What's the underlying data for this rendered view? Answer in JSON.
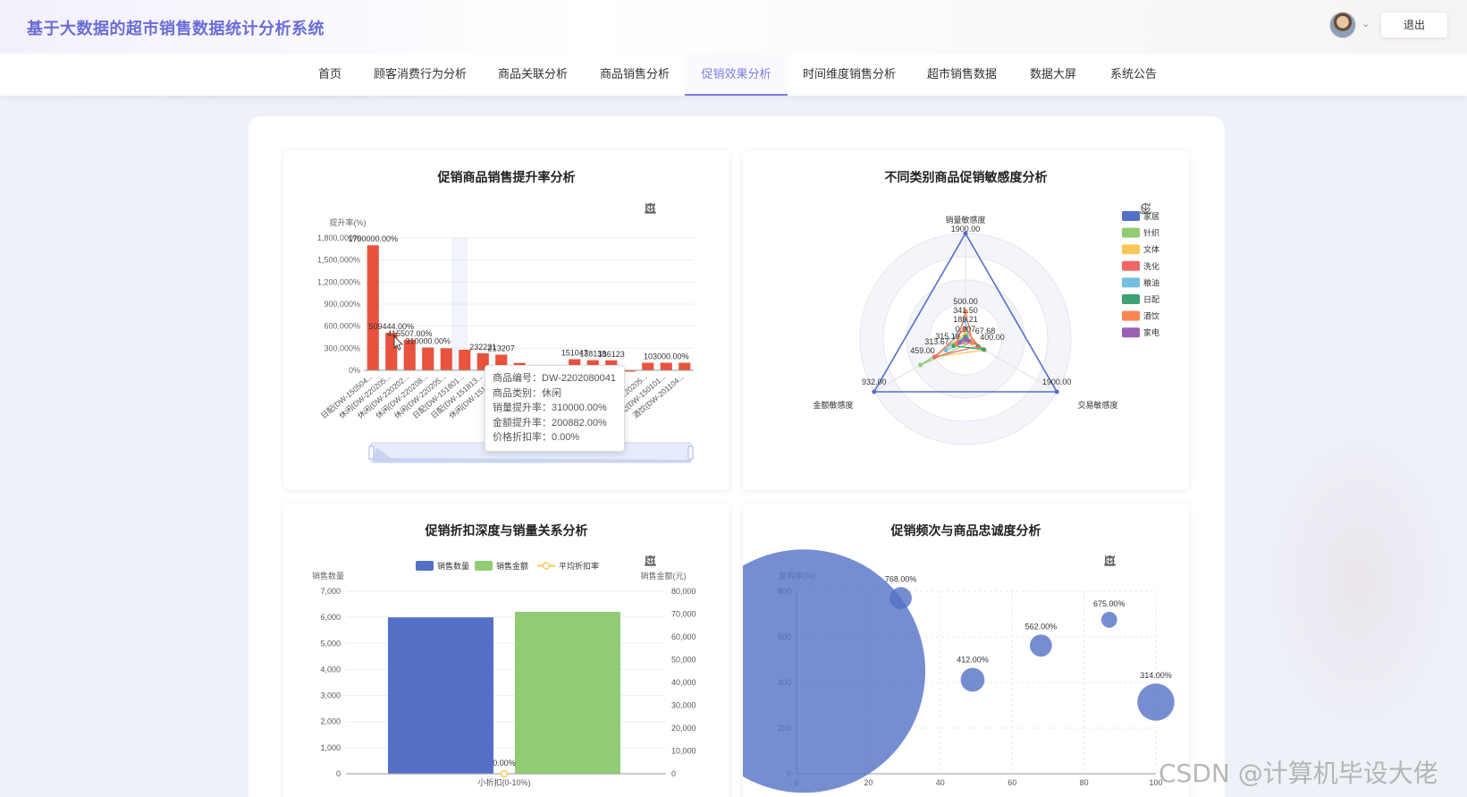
{
  "app": {
    "title": "基于大数据的超市销售数据统计分析系统",
    "logout": "退出"
  },
  "nav": [
    {
      "label": "首页"
    },
    {
      "label": "顾客消费行为分析"
    },
    {
      "label": "商品关联分析"
    },
    {
      "label": "商品销售分析"
    },
    {
      "label": "促销效果分析",
      "active": true
    },
    {
      "label": "时间维度销售分析"
    },
    {
      "label": "超市销售数据"
    },
    {
      "label": "数据大屏"
    },
    {
      "label": "系统公告"
    }
  ],
  "toolbox_icons": [
    "zoom-icon",
    "zoom-reset-icon",
    "restore-icon",
    "download-icon"
  ],
  "colors": {
    "accent": "#7a7ee2",
    "bar_red": "#e8533e",
    "blue": "#5470c6",
    "green": "#91cc75",
    "yellow": "#fac858"
  },
  "chart1": {
    "title": "促销商品销售提升率分析",
    "tooltip": [
      "商品编号：DW-2202080041",
      "商品类别：休闲",
      "销量提升率：310000.00%",
      "金额提升率：200882.00%",
      "价格折扣率：0.00%"
    ]
  },
  "chart2": {
    "title": "不同类别商品促销敏感度分析"
  },
  "chart3": {
    "title": "促销折扣深度与销量关系分析"
  },
  "chart4": {
    "title": "促销频次与商品忠诚度分析"
  },
  "watermark": "CSDN @计算机毕设大佬",
  "chart_data": [
    {
      "type": "bar",
      "title": "促销商品销售提升率分析",
      "ylabel": "提升率(%)",
      "ylim": [
        0,
        1800000
      ],
      "yticks": [
        "0%",
        "300,000%",
        "600,000%",
        "900,000%",
        "1,200,000%",
        "1,500,000%",
        "1,800,000%"
      ],
      "categories": [
        "日配(DW-150504...",
        "休闲(DW-220205...",
        "休闲(DW-220202...",
        "休闲(DW-220208...",
        "休闲(DW-220205...",
        "日配(DW-151801...",
        "日配(DW-151813...",
        "休闲(DW-151904...",
        "酒饮",
        "",
        "",
        "",
        "",
        "",
        "",
        "休闲(DW-220205...",
        "日配(DW-150101...",
        "酒饮(DW-201104..."
      ],
      "values": [
        1700000,
        509444,
        415507,
        310000,
        300000,
        280000,
        232221,
        213207,
        100400,
        45001,
        45000,
        151047,
        138138,
        136123,
        100,
        103000,
        103000,
        103000
      ],
      "labels": [
        "1700000.00%",
        "509444.00%",
        "415507.00%",
        "310000.00%",
        "",
        "",
        "232221",
        "213207",
        "",
        "",
        "",
        "151047",
        "138138",
        "136123",
        "",
        "",
        "103000.00%",
        ""
      ],
      "grid": true
    },
    {
      "type": "radar",
      "title": "不同类别商品促销敏感度分析",
      "indicators": [
        {
          "name": "销量敏感度",
          "max": 1900
        },
        {
          "name": "交易敏感度",
          "max": 1900
        },
        {
          "name": "金额敏感度",
          "max": 932
        }
      ],
      "max_labels": [
        "1900.00",
        "1900.00",
        "932.00"
      ],
      "value_labels": [
        "500.00",
        "341.50",
        "189.21",
        "0.007",
        "313.67",
        "315.19",
        "459.00",
        "67.68",
        "400.00"
      ],
      "legend": [
        "家居",
        "针织",
        "文体",
        "洗化",
        "粮油",
        "日配",
        "酒饮",
        "家电"
      ],
      "legend_colors": [
        "#5470c6",
        "#91cc75",
        "#fac858",
        "#ee6666",
        "#73c0de",
        "#3ba272",
        "#fc8452",
        "#9a60b4"
      ],
      "series": [
        {
          "name": "家居",
          "values": [
            1900,
            1900,
            932
          ]
        },
        {
          "name": "针织",
          "values": [
            60,
            120,
            459
          ]
        },
        {
          "name": "文体",
          "values": [
            110,
            400,
            313.67
          ]
        },
        {
          "name": "洗化",
          "values": [
            189.21,
            260,
            315.19
          ]
        },
        {
          "name": "粮油",
          "values": [
            341.5,
            67.68,
            200
          ]
        },
        {
          "name": "日配",
          "values": [
            40,
            380,
            120
          ]
        },
        {
          "name": "酒饮",
          "values": [
            500,
            150,
            90
          ]
        },
        {
          "name": "家电",
          "values": [
            0.007,
            60,
            60
          ]
        }
      ],
      "legend_position": "right"
    },
    {
      "type": "bar",
      "title": "促销折扣深度与销量关系分析",
      "categories": [
        "小折扣(0-10%)"
      ],
      "series": [
        {
          "name": "销售数量",
          "values": [
            6000
          ],
          "axis": "left"
        },
        {
          "name": "销售金额",
          "values": [
            71000
          ],
          "axis": "right"
        },
        {
          "name": "平均折扣率",
          "values": [
            0
          ],
          "type": "line",
          "label": "0.00%"
        }
      ],
      "ylabel": "销售数量",
      "ylim": [
        0,
        7000
      ],
      "yticks": [
        "0",
        "1,000",
        "2,000",
        "3,000",
        "4,000",
        "5,000",
        "6,000",
        "7,000"
      ],
      "y2label": "销售金额(元)",
      "y2lim": [
        0,
        80000
      ],
      "y2ticks": [
        "0",
        "10,000",
        "20,000",
        "30,000",
        "40,000",
        "50,000",
        "60,000",
        "70,000",
        "80,000"
      ],
      "legend_position": "top-center"
    },
    {
      "type": "scatter",
      "title": "促销频次与商品忠诚度分析",
      "ylabel": "复购率(%)",
      "xlim": [
        0,
        100
      ],
      "ylim": [
        0,
        800
      ],
      "xticks": [
        "0",
        "20",
        "40",
        "60",
        "80",
        "100"
      ],
      "yticks": [
        "0",
        "200",
        "400",
        "600",
        "800"
      ],
      "points": [
        {
          "x": 2,
          "y": 450,
          "r": 1,
          "label": ""
        },
        {
          "x": 29,
          "y": 770,
          "r": 0.25,
          "label": "768.00%"
        },
        {
          "x": 49,
          "y": 412,
          "r": 0.27,
          "label": "412.00%"
        },
        {
          "x": 68,
          "y": 562,
          "r": 0.25,
          "label": "562.00%"
        },
        {
          "x": 87,
          "y": 675,
          "r": 0.18,
          "label": "675.00%"
        },
        {
          "x": 100,
          "y": 314,
          "r": 0.42,
          "label": "314.00%"
        }
      ]
    }
  ]
}
